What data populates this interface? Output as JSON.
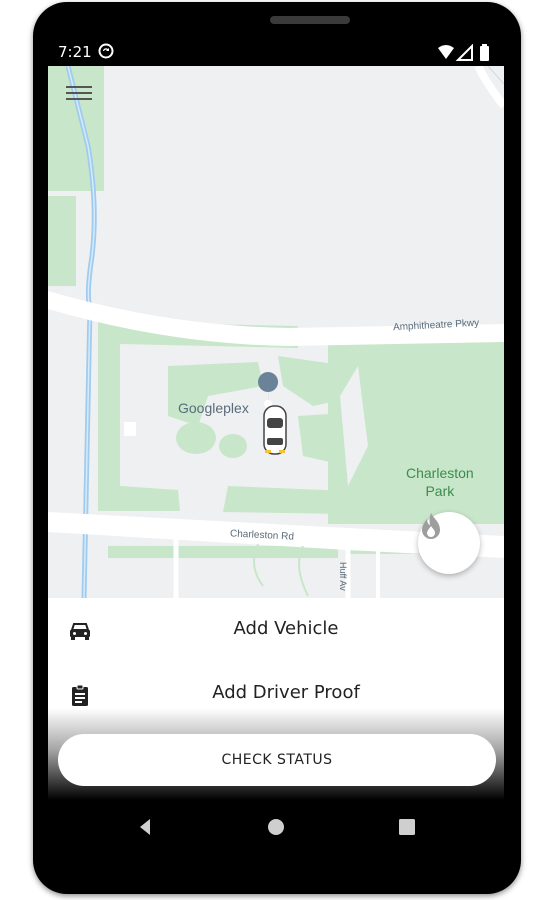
{
  "status_bar": {
    "time": "7:21",
    "icons": [
      "sync-icon",
      "wifi-icon",
      "signal-icon",
      "battery-icon"
    ]
  },
  "map": {
    "labels": {
      "googleplex": "Googleplex",
      "amphitheatre": "Amphitheatre Pkwy",
      "charleston_rd": "Charleston Rd",
      "huff": "Huff Av",
      "charleston_park_line1": "Charleston",
      "charleston_park_line2": "Park"
    },
    "colors": {
      "land": "#eef0f1",
      "green": "#c8e6c9",
      "road": "#ffffff",
      "water": "#9ecbf0",
      "pin": "#6b8398"
    }
  },
  "actions": {
    "add_vehicle": "Add Vehicle",
    "add_driver_proof": "Add Driver Proof",
    "check_status": "CHECK STATUS"
  },
  "icons": {
    "menu": "hamburger-menu-icon",
    "fab": "flame-icon",
    "vehicle": "car-icon",
    "proof": "clipboard-icon"
  }
}
